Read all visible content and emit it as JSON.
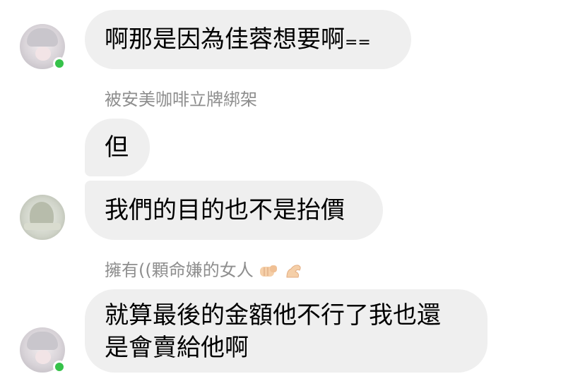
{
  "messages": [
    {
      "text": "啊那是因為佳蓉想要啊",
      "suffix": "=="
    },
    {
      "sender": "被安美咖啡立牌綁架",
      "text": "但"
    },
    {
      "text": "我們的目的也不是抬價"
    },
    {
      "sender": "擁有((顆命嫌的女人",
      "sender_emojis": [
        "fist-emoji",
        "flexed-arm-emoji"
      ],
      "lines": [
        "就算最後的金額他不行了我也還",
        "是會賣給他啊"
      ]
    }
  ],
  "colors": {
    "bubble": "#efefef",
    "sender_name": "#8e8e8e",
    "online": "#36c24a",
    "background": "#ffffff"
  }
}
